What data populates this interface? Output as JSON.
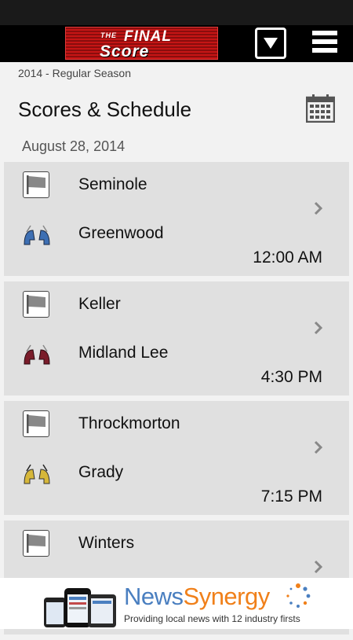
{
  "app": {
    "logo": {
      "the": "THE",
      "final": "FINAL",
      "score": "Score"
    }
  },
  "header": {
    "season": "2014 - Regular Season",
    "title": "Scores & Schedule"
  },
  "date": "August 28, 2014",
  "games": [
    {
      "home": "Seminole",
      "away": "Greenwood",
      "time": "12:00 AM",
      "helmet_color": "#3d6fb3"
    },
    {
      "home": "Keller",
      "away": "Midland Lee",
      "time": "4:30 PM",
      "helmet_color": "#7a1c2a"
    },
    {
      "home": "Throckmorton",
      "away": "Grady",
      "time": "7:15 PM",
      "helmet_color": "#d6b73a"
    },
    {
      "home": "Winters",
      "away": "",
      "time": "",
      "helmet_color": ""
    }
  ],
  "ad": {
    "brand_part1": "News",
    "brand_part2": "Synergy",
    "tagline": "Providing local news with 12 industry firsts"
  },
  "icons": {
    "dropdown": "dropdown-triangle-icon",
    "menu": "hamburger-menu-icon",
    "calendar": "calendar-icon",
    "flag": "flag-icon",
    "chevron": "chevron-right-icon"
  }
}
